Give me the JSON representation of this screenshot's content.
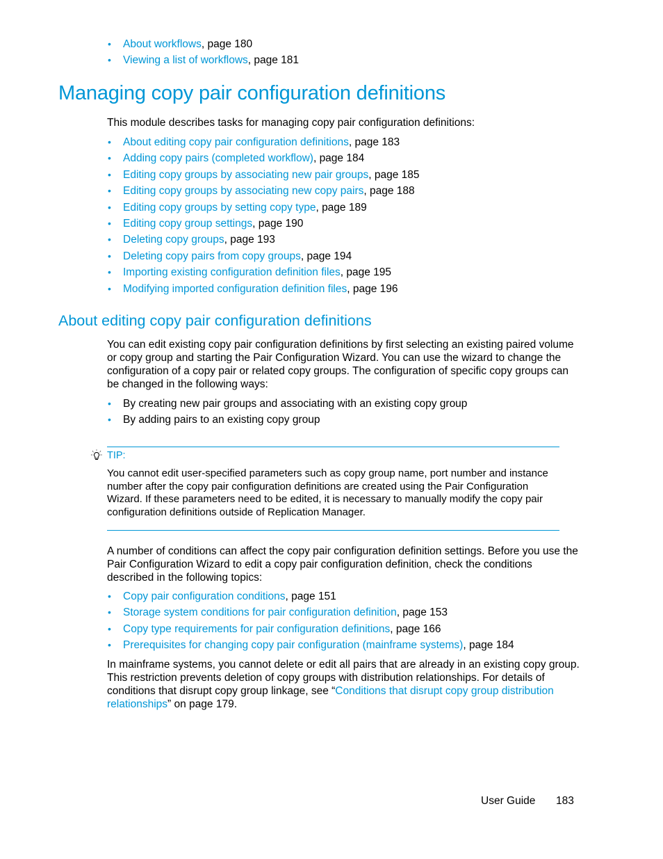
{
  "top_list": [
    {
      "link": "About workflows",
      "suffix": ", page 180"
    },
    {
      "link": "Viewing a list of workflows",
      "suffix": ", page 181"
    }
  ],
  "section": {
    "title": "Managing copy pair configuration definitions",
    "intro": "This module describes tasks for managing copy pair configuration definitions:",
    "items": [
      {
        "link": "About editing copy pair configuration definitions",
        "suffix": ", page 183"
      },
      {
        "link": "Adding copy pairs (completed workflow)",
        "suffix": ", page 184"
      },
      {
        "link": "Editing copy groups by associating new pair groups",
        "suffix": ", page 185"
      },
      {
        "link": "Editing copy groups by associating new copy pairs",
        "suffix": ", page 188"
      },
      {
        "link": "Editing copy groups by setting copy type",
        "suffix": ", page 189"
      },
      {
        "link": "Editing copy group settings",
        "suffix": ", page 190"
      },
      {
        "link": "Deleting copy groups",
        "suffix": ", page 193"
      },
      {
        "link": "Deleting copy pairs from copy groups",
        "suffix": ", page 194"
      },
      {
        "link": "Importing existing configuration definition files",
        "suffix": ", page 195"
      },
      {
        "link": "Modifying imported configuration definition files",
        "suffix": ", page 196"
      }
    ]
  },
  "subsection": {
    "title": "About editing copy pair configuration definitions",
    "para1": "You can edit existing copy pair configuration definitions by first selecting an existing paired volume or copy group and starting the Pair Configuration Wizard. You can use the wizard to change the configuration of a copy pair or related copy groups. The configuration of specific copy groups can be changed in the following ways:",
    "ways": [
      "By creating new pair groups and associating with an existing copy group",
      "By adding pairs to an existing copy group"
    ],
    "tip": {
      "label": "TIP:",
      "text": "You cannot edit user-specified parameters such as copy group name, port number and instance number after the copy pair configuration definitions are created using the Pair Configuration Wizard. If these parameters need to be edited, it is necessary to manually modify the copy pair configuration definitions outside of Replication Manager."
    },
    "para2": "A number of conditions can affect the copy pair configuration definition settings. Before you use the Pair Configuration Wizard to edit a copy pair configuration definition, check the conditions described in the following topics:",
    "topics": [
      {
        "link": "Copy pair configuration conditions",
        "suffix": ", page 151"
      },
      {
        "link": "Storage system conditions for pair configuration definition",
        "suffix": ", page 153"
      },
      {
        "link": "Copy type requirements for pair configuration definitions",
        "suffix": ", page 166"
      },
      {
        "link": "Prerequisites for changing copy pair configuration (mainframe systems)",
        "suffix": ", page 184"
      }
    ],
    "para3_prefix": "In mainframe systems, you cannot delete or edit all pairs that are already in an existing copy group. This restriction prevents deletion of copy groups with distribution relationships. For details of conditions that disrupt copy group linkage, see “",
    "para3_link": "Conditions that disrupt copy group distribution relationships",
    "para3_suffix": "” on page 179."
  },
  "footer": {
    "label": "User Guide",
    "page": "183"
  },
  "colors": {
    "accent": "#0096d6",
    "text": "#000000"
  }
}
